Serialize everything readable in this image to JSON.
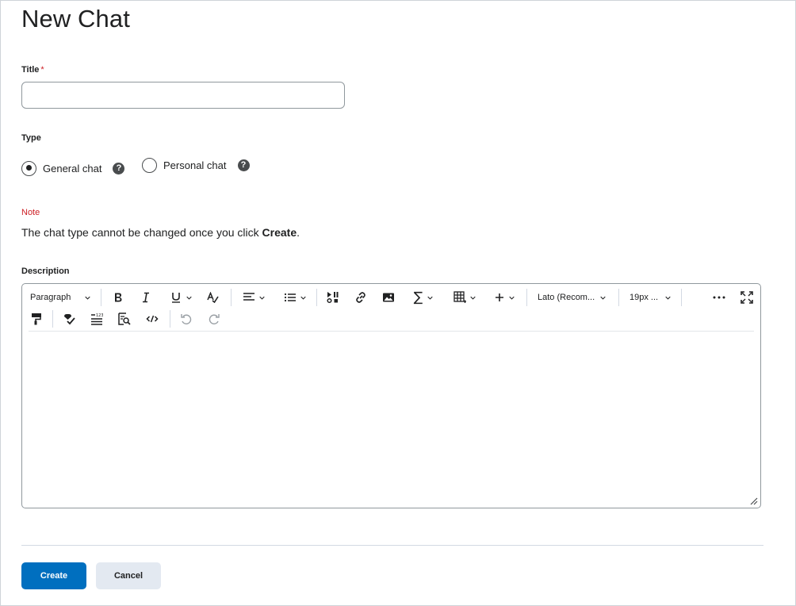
{
  "page": {
    "title": "New Chat"
  },
  "title_field": {
    "label": "Title",
    "required_mark": "*",
    "value": "",
    "placeholder": ""
  },
  "type_field": {
    "label": "Type",
    "options": [
      {
        "label": "General chat",
        "checked": true
      },
      {
        "label": "Personal chat",
        "checked": false
      }
    ]
  },
  "note": {
    "label": "Note",
    "text_before": "The chat type cannot be changed once you click ",
    "text_bold": "Create",
    "text_after": "."
  },
  "description": {
    "label": "Description",
    "toolbar": {
      "block_format": "Paragraph",
      "font_family": "Lato (Recom...",
      "font_size": "19px ...",
      "icons": [
        "bold-icon",
        "italic-icon",
        "underline-icon",
        "clear-format-icon",
        "align-icon",
        "list-icon",
        "insert-stuff-icon",
        "link-icon",
        "image-icon",
        "equation-icon",
        "table-icon",
        "insert-more-icon",
        "more-icon",
        "fullscreen-icon",
        "format-painter-icon",
        "accessibility-checker-icon",
        "word-count-icon",
        "preview-icon",
        "source-code-icon",
        "undo-icon",
        "redo-icon"
      ]
    },
    "content": ""
  },
  "actions": {
    "primary": "Create",
    "secondary": "Cancel"
  },
  "colors": {
    "primary": "#006fbf",
    "secondary": "#e3e9f1",
    "required": "#cd2026",
    "border": "#90989d"
  }
}
